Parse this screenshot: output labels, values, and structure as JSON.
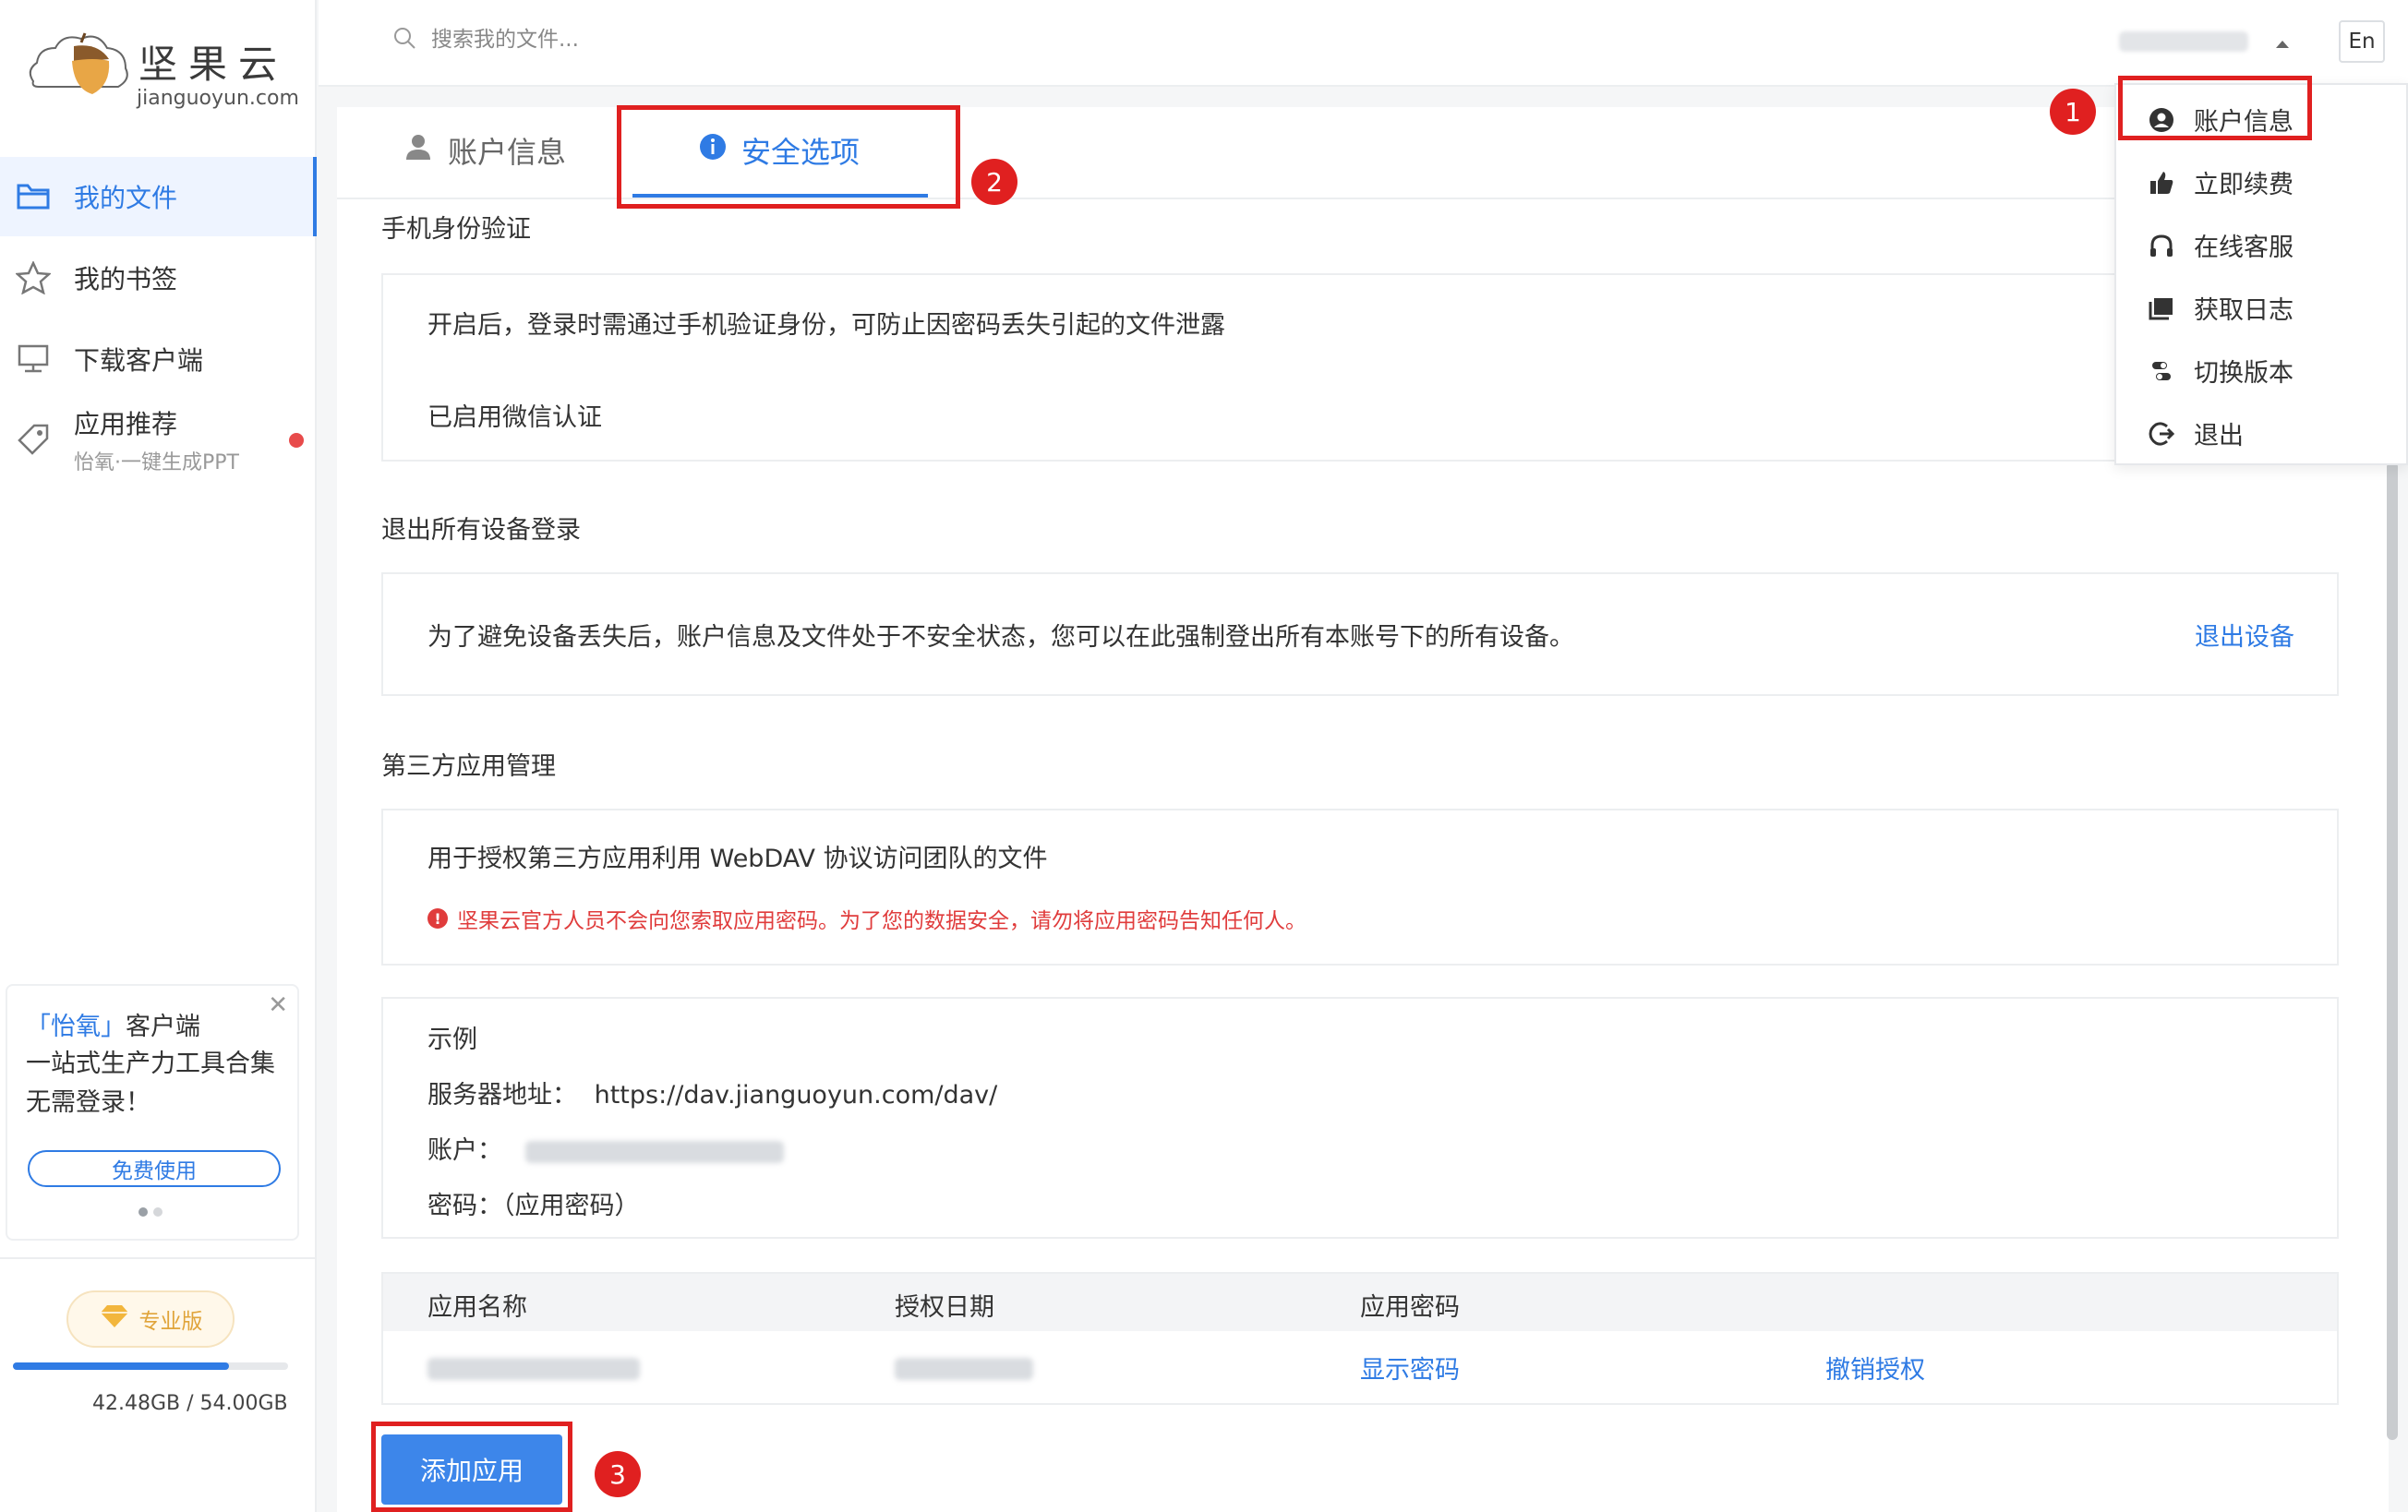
{
  "brand": {
    "name": "坚果云",
    "domain": "jianguoyun.com"
  },
  "sidebar": {
    "items": [
      {
        "label": "我的文件",
        "icon": "folder-icon"
      },
      {
        "label": "我的书签",
        "icon": "star-icon"
      },
      {
        "label": "下载客户端",
        "icon": "monitor-icon"
      },
      {
        "label": "应用推荐",
        "icon": "tag-icon",
        "sub": "怡氧·一键生成PPT"
      }
    ],
    "promo": {
      "title_highlight": "「怡氧」",
      "title_rest": "客户端",
      "desc": "一站式生产力工具合集 无需登录！",
      "button": "免费使用"
    },
    "plan": "专业版",
    "storage": {
      "used_fraction": 0.785,
      "text": "42.48GB / 54.00GB"
    }
  },
  "topbar": {
    "search_placeholder": "搜索我的文件...",
    "lang": "En"
  },
  "tabs": [
    {
      "label": "账户信息",
      "icon": "person-icon"
    },
    {
      "label": "安全选项",
      "icon": "info-icon"
    }
  ],
  "sections": {
    "phone": {
      "title": "手机身份验证",
      "desc": "开启后，登录时需通过手机验证身份，可防止因密码丢失引起的文件泄露",
      "status": "已启用微信认证"
    },
    "logout": {
      "title": "退出所有设备登录",
      "desc": "为了避免设备丢失后，账户信息及文件处于不安全状态，您可以在此强制登出所有本账号下的所有设备。",
      "action": "退出设备"
    },
    "third_party": {
      "title": "第三方应用管理",
      "desc": "用于授权第三方应用利用 WebDAV 协议访问团队的文件",
      "warning": "坚果云官方人员不会向您索取应用密码。为了您的数据安全，请勿将应用密码告知任何人。",
      "example_title": "示例",
      "server_label": "服务器地址：",
      "server_value": "https://dav.jianguoyun.com/dav/",
      "account_label": "账户：",
      "password_label": "密码：（应用密码）"
    }
  },
  "table": {
    "headers": [
      "应用名称",
      "授权日期",
      "应用密码"
    ],
    "row": {
      "show_password": "显示密码",
      "revoke": "撤销授权"
    }
  },
  "add_button": "添加应用",
  "dropdown": {
    "items": [
      {
        "label": "账户信息",
        "icon": "account-circle-icon"
      },
      {
        "label": "立即续费",
        "icon": "thumbs-up-icon"
      },
      {
        "label": "在线客服",
        "icon": "headset-icon"
      },
      {
        "label": "获取日志",
        "icon": "log-icon"
      },
      {
        "label": "切换版本",
        "icon": "toggle-icon"
      },
      {
        "label": "退出",
        "icon": "logout-icon"
      }
    ]
  },
  "annotations": [
    "1",
    "2",
    "3"
  ]
}
